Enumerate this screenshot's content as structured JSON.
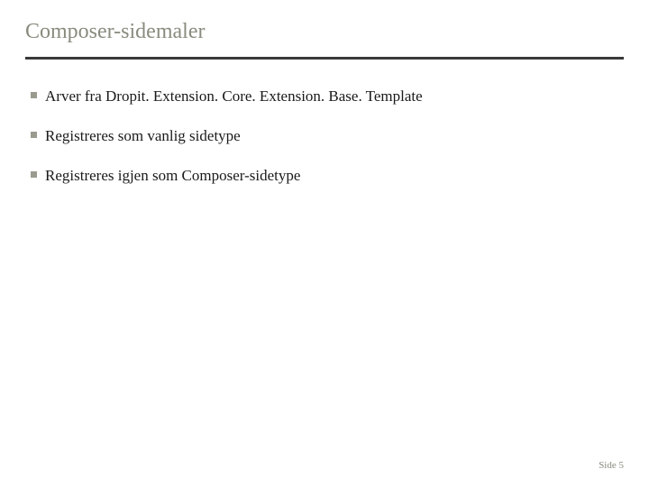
{
  "title": "Composer-sidemaler",
  "bullets": [
    "Arver fra Dropit. Extension. Core. Extension. Base. Template",
    "Registreres som vanlig sidetype",
    "Registreres igjen som Composer-sidetype"
  ],
  "footer": "Side 5"
}
